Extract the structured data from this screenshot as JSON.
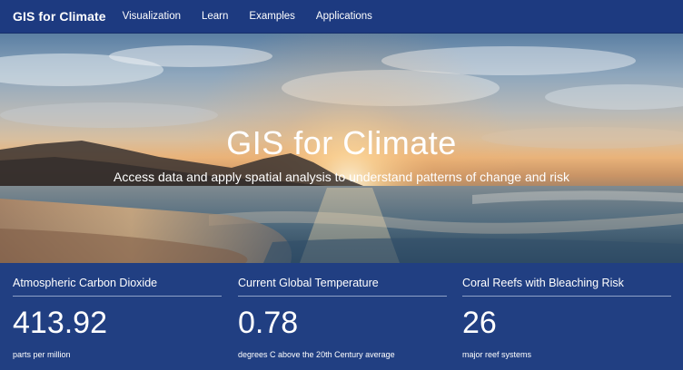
{
  "nav": {
    "brand": "GIS for Climate",
    "items": [
      {
        "label": "Visualization"
      },
      {
        "label": "Learn"
      },
      {
        "label": "Examples"
      },
      {
        "label": "Applications"
      }
    ]
  },
  "hero": {
    "title": "GIS for Climate",
    "subtitle": "Access data and apply spatial analysis to understand patterns of change and risk"
  },
  "stats": [
    {
      "label": "Atmospheric Carbon Dioxide",
      "value": "413.92",
      "unit": "parts per million"
    },
    {
      "label": "Current Global Temperature",
      "value": "0.78",
      "unit": "degrees C above the 20th Century average"
    },
    {
      "label": "Coral Reefs with Bleaching Risk",
      "value": "26",
      "unit": "major reef systems"
    }
  ],
  "colors": {
    "nav_background": "#1d3a80",
    "stats_background": "#213f82",
    "text": "#ffffff"
  }
}
